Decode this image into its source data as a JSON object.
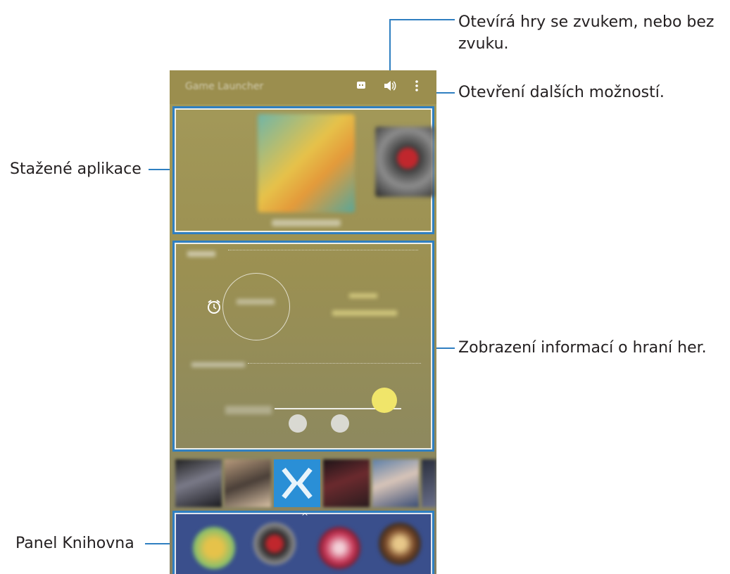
{
  "app": {
    "title": "Game Launcher"
  },
  "toolbar": {
    "discord_icon": "chat-icon",
    "sound_icon": "speaker-icon",
    "more_icon": "kebab-menu-icon"
  },
  "callouts": {
    "sound": "Otevírá hry se zvukem, nebo bez zvuku.",
    "more": "Otevření dalších možností.",
    "downloaded": "Stažené aplikace",
    "info": "Zobrazení informací o hraní her.",
    "library": "Panel Knihovna"
  },
  "colors": {
    "accent": "#2f7fc1",
    "library_bg": "#3a4f8c",
    "appbar": "#9b8e4e"
  }
}
